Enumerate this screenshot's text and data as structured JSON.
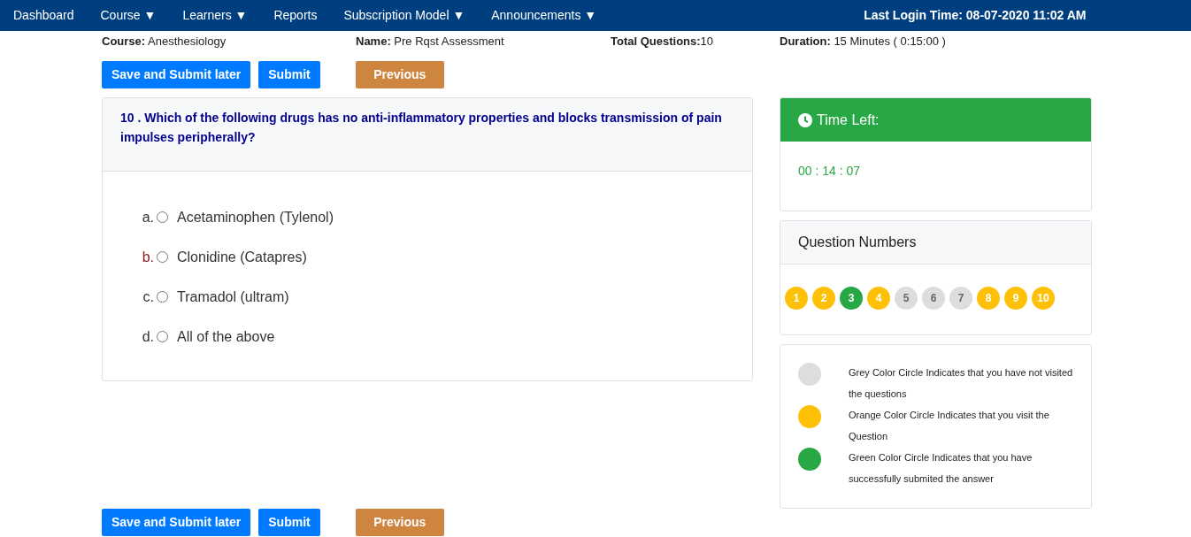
{
  "nav": {
    "items": [
      {
        "label": "Dashboard"
      },
      {
        "label": "Course ▼"
      },
      {
        "label": "Learners ▼"
      },
      {
        "label": "Reports"
      },
      {
        "label": "Subscription Model ▼"
      },
      {
        "label": "Announcements ▼"
      }
    ],
    "last_login": "Last Login Time: 08-07-2020 11:02 AM"
  },
  "info": [
    {
      "label": "Course:",
      "value": " Anesthesiology"
    },
    {
      "label": "Name:",
      "value": " Pre Rqst Assessment"
    },
    {
      "label": "Total Questions:",
      "value": "10"
    },
    {
      "label": "Duration:",
      "value": " 15 Minutes ( 0:15:00 )"
    }
  ],
  "top_buttons": [
    {
      "label": "Save and Submit later",
      "kind": "primary"
    },
    {
      "label": "Submit",
      "kind": "primary"
    },
    {
      "label": "Previous",
      "kind": "secondary"
    }
  ],
  "question": {
    "text": "10 . Which of the following drugs has no anti-inflammatory properties and blocks transmission of pain impulses peripherally?",
    "options": [
      {
        "letter": "a.",
        "text": "Acetaminophen (Tylenol)",
        "checked": false,
        "color": "#333333"
      },
      {
        "letter": "b.",
        "text": "Clonidine (Catapres)",
        "checked": false,
        "color": "#8b1a1a"
      },
      {
        "letter": "c.",
        "text": "Tramadol (ultram)",
        "checked": false,
        "color": "#333333"
      },
      {
        "letter": "d.",
        "text": "All of the above",
        "checked": false,
        "color": "#333333"
      }
    ]
  },
  "timer": {
    "title": "Time Left:",
    "value": "00 : 14 : 07"
  },
  "question_numbers": {
    "title": "Question Numbers",
    "items": [
      {
        "label": "1",
        "color": "#ffc107"
      },
      {
        "label": "2",
        "color": "#ffc107"
      },
      {
        "label": "3",
        "color": "#28a745"
      },
      {
        "label": "4",
        "color": "#ffc107"
      },
      {
        "label": "5",
        "color": "#dddddd"
      },
      {
        "label": "6",
        "color": "#dddddd"
      },
      {
        "label": "7",
        "color": "#dddddd"
      },
      {
        "label": "8",
        "color": "#ffc107"
      },
      {
        "label": "9",
        "color": "#ffc107"
      },
      {
        "label": "10",
        "color": "#ffc107"
      }
    ]
  },
  "legend": [
    {
      "color": "#dddddd",
      "text": "Grey Color Circle Indicates that you have not visited the questions"
    },
    {
      "color": "#ffc107",
      "text": "Orange Color Circle Indicates that you visit the Question"
    },
    {
      "color": "#28a745",
      "text": "Green Color Circle Indicates that you have successfully submited the answer"
    }
  ],
  "bottom_buttons": [
    {
      "label": "Save and Submit later",
      "kind": "primary"
    },
    {
      "label": "Submit",
      "kind": "primary"
    },
    {
      "label": "Previous",
      "kind": "secondary"
    }
  ]
}
